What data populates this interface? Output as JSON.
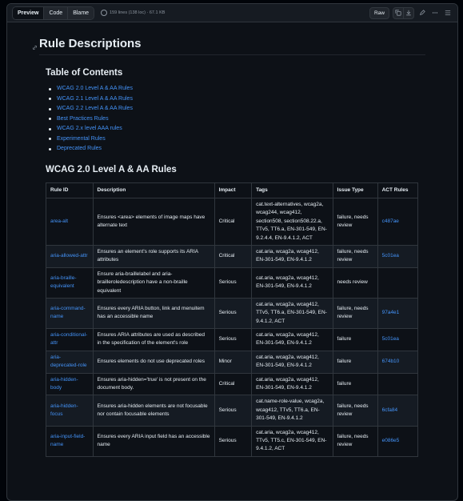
{
  "toolbar": {
    "tabs": [
      "Preview",
      "Code",
      "Blame"
    ],
    "file_info": "159 lines (138 loc) · 67.1 KB",
    "raw_label": "Raw"
  },
  "page": {
    "title": "Rule Descriptions",
    "toc_heading": "Table of Contents",
    "toc": [
      "WCAG 2.0 Level A & AA Rules",
      "WCAG 2.1 Level A & AA Rules",
      "WCAG 2.2 Level A & AA Rules",
      "Best Practices Rules",
      "WCAG 2.x level AAA rules",
      "Experimental Rules",
      "Deprecated Rules"
    ],
    "section_heading": "WCAG 2.0 Level A & AA Rules"
  },
  "table": {
    "headers": [
      "Rule ID",
      "Description",
      "Impact",
      "Tags",
      "Issue Type",
      "ACT Rules"
    ],
    "rows": [
      [
        "area-alt",
        "Ensures <area> elements of image maps have alternate text",
        "Critical",
        "cat.text-alternatives, wcag2a, wcag244, wcag412, section508, section508.22.a, TTv5, TT6.a, EN-301-549, EN-9.2.4.4, EN-9.4.1.2, ACT",
        "failure, needs review",
        "c487ae"
      ],
      [
        "aria-allowed-attr",
        "Ensures an element's role supports its ARIA attributes",
        "Critical",
        "cat.aria, wcag2a, wcag412, EN-301-549, EN-9.4.1.2",
        "failure, needs review",
        "5c01ea"
      ],
      [
        "aria-braille-equivalent",
        "Ensure aria-braillelabel and aria-brailleroledescription have a non-braille equivalent",
        "Serious",
        "cat.aria, wcag2a, wcag412, EN-301-549, EN-9.4.1.2",
        "needs review",
        ""
      ],
      [
        "aria-command-name",
        "Ensures every ARIA button, link and menuitem has an accessible name",
        "Serious",
        "cat.aria, wcag2a, wcag412, TTv5, TT6.a, EN-301-549, EN-9.4.1.2, ACT",
        "failure, needs review",
        "97a4e1"
      ],
      [
        "aria-conditional-attr",
        "Ensures ARIA attributes are used as described in the specification of the element's role",
        "Serious",
        "cat.aria, wcag2a, wcag412, EN-301-549, EN-9.4.1.2",
        "failure",
        "5c01ea"
      ],
      [
        "aria-deprecated-role",
        "Ensures elements do not use deprecated roles",
        "Minor",
        "cat.aria, wcag2a, wcag412, EN-301-549, EN-9.4.1.2",
        "failure",
        "674b10"
      ],
      [
        "aria-hidden-body",
        "Ensures aria-hidden='true' is not present on the document body.",
        "Critical",
        "cat.aria, wcag2a, wcag412, EN-301-549, EN-9.4.1.2",
        "failure",
        ""
      ],
      [
        "aria-hidden-focus",
        "Ensures aria-hidden elements are not focusable nor contain focusable elements",
        "Serious",
        "cat.name-role-value, wcag2a, wcag412, TTv5, TT6.a, EN-301-549, EN-9.4.1.2",
        "failure, needs review",
        "6cfa84"
      ],
      [
        "aria-input-field-name",
        "Ensures every ARIA input field has an accessible name",
        "Serious",
        "cat.aria, wcag2a, wcag412, TTv5, TT5.c, EN-301-549, EN-9.4.1.2, ACT",
        "failure, needs review",
        "e086e5"
      ]
    ]
  },
  "colors": {
    "background": "#0d1117",
    "link": "#4493f8",
    "border": "#30363d",
    "text": "#e6edf3"
  }
}
